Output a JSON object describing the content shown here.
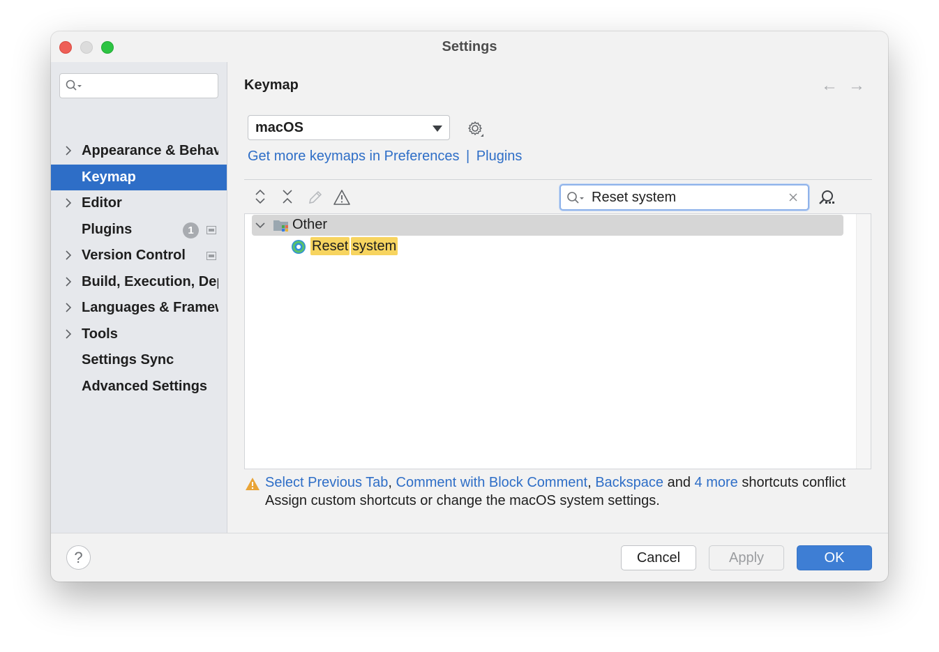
{
  "window": {
    "title": "Settings"
  },
  "sidebar": {
    "search_placeholder": "",
    "items": [
      {
        "label": "Appearance & Behavior",
        "expandable": true,
        "selected": false
      },
      {
        "label": "Keymap",
        "expandable": false,
        "selected": true
      },
      {
        "label": "Editor",
        "expandable": true,
        "selected": false
      },
      {
        "label": "Plugins",
        "expandable": false,
        "selected": false,
        "badge": "1"
      },
      {
        "label": "Version Control",
        "expandable": true,
        "selected": false
      },
      {
        "label": "Build, Execution, Deployment",
        "expandable": true,
        "selected": false
      },
      {
        "label": "Languages & Frameworks",
        "expandable": true,
        "selected": false
      },
      {
        "label": "Tools",
        "expandable": true,
        "selected": false
      },
      {
        "label": "Settings Sync",
        "expandable": false,
        "selected": false
      },
      {
        "label": "Advanced Settings",
        "expandable": false,
        "selected": false
      }
    ]
  },
  "main": {
    "title": "Keymap",
    "keymap_select": {
      "value": "macOS"
    },
    "links": {
      "prefix": "Get more keymaps in Preferences",
      "separator": "|",
      "plugins": "Plugins"
    },
    "filter": {
      "value": "Reset system"
    },
    "tree": {
      "group": "Other",
      "action_words": [
        "Reset",
        "system"
      ]
    },
    "conflict": {
      "link1": "Select Previous Tab",
      "sep1": ",",
      "link2": "Comment with Block Comment",
      "sep2": ",",
      "link3": "Backspace",
      "and": "and",
      "link4": "4 more",
      "suffix": "shortcuts conflict",
      "subtext": "Assign custom shortcuts or change the macOS system settings."
    }
  },
  "footer": {
    "help": "?",
    "cancel": "Cancel",
    "apply": "Apply",
    "ok": "OK"
  },
  "colors": {
    "accent": "#2e6ec7",
    "selected_bg": "#2e6ec7",
    "highlight": "#f7d45f",
    "ok_button": "#3e7ed4"
  }
}
